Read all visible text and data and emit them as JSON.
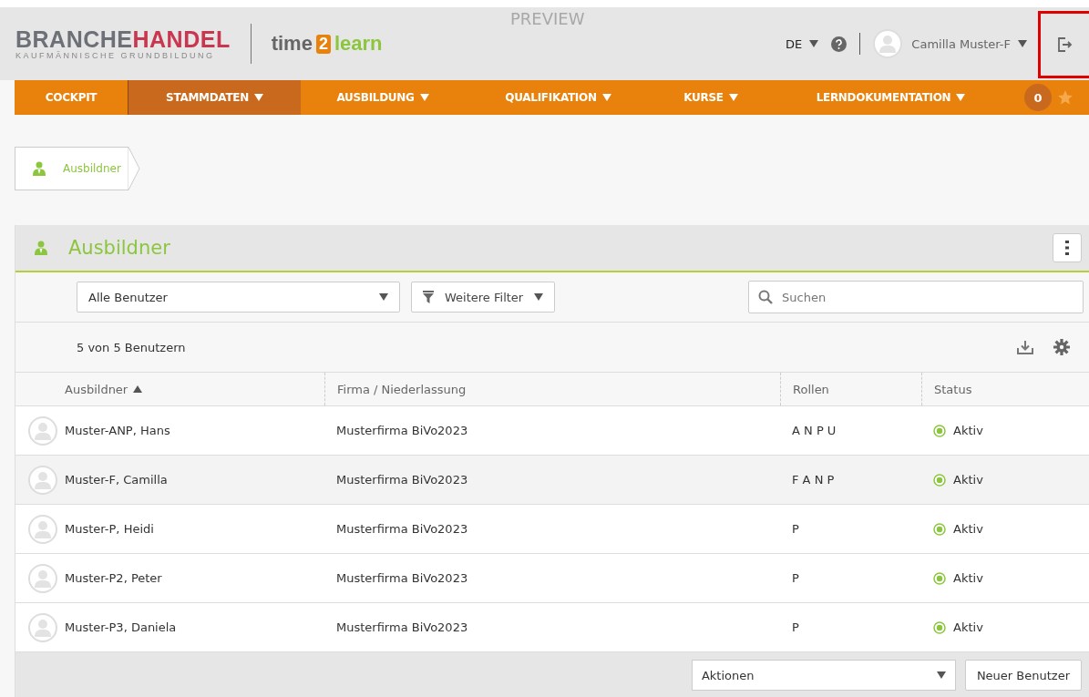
{
  "header": {
    "brand": {
      "part1": "BRANCHE",
      "part2": "HANDEL",
      "tagline": "KAUFMÄNNISCHE GRUNDBILDUNG"
    },
    "app_logo": {
      "part1": "time",
      "part2": "2",
      "part3": "learn"
    },
    "preview_label": "PREVIEW",
    "language": "DE",
    "user_name": "Camilla Muster-F",
    "logout_highlighted": true
  },
  "nav": {
    "items": [
      {
        "label": "COCKPIT",
        "dropdown": false,
        "selected": false
      },
      {
        "label": "STAMMDATEN",
        "dropdown": true,
        "selected": true
      },
      {
        "label": "AUSBILDUNG",
        "dropdown": true,
        "selected": false
      },
      {
        "label": "QUALIFIKATION",
        "dropdown": true,
        "selected": false
      },
      {
        "label": "KURSE",
        "dropdown": true,
        "selected": false
      },
      {
        "label": "LERNDOKUMENTATION",
        "dropdown": true,
        "selected": false
      }
    ],
    "badge": "0"
  },
  "breadcrumb": [
    "Ausbildner"
  ],
  "panel": {
    "title": "Ausbildner",
    "filter_select": "Alle Benutzer",
    "filter_button": "Weitere Filter",
    "search": {
      "placeholder": "Suchen"
    },
    "count": "5 von 5 Benutzern",
    "table": {
      "columns": [
        {
          "label": "Ausbildner",
          "sorted_ascending": true
        },
        {
          "label": "Firma / Niederlassung",
          "sorted_ascending": false
        },
        {
          "label": "Rollen",
          "sorted_ascending": false
        },
        {
          "label": "Status",
          "sorted_ascending": false
        }
      ],
      "rows": [
        {
          "name": "Muster-ANP, Hans",
          "company": "Musterfirma BiVo2023",
          "roles": "A N P U",
          "status": "Aktiv",
          "active": true,
          "shaded": false
        },
        {
          "name": "Muster-F, Camilla",
          "company": "Musterfirma BiVo2023",
          "roles": "F A N P",
          "status": "Aktiv",
          "active": true,
          "shaded": true
        },
        {
          "name": "Muster-P, Heidi",
          "company": "Musterfirma BiVo2023",
          "roles": "P",
          "status": "Aktiv",
          "active": true,
          "shaded": false
        },
        {
          "name": "Muster-P2, Peter",
          "company": "Musterfirma BiVo2023",
          "roles": "P",
          "status": "Aktiv",
          "active": true,
          "shaded": false
        },
        {
          "name": "Muster-P3, Daniela",
          "company": "Musterfirma BiVo2023",
          "roles": "P",
          "status": "Aktiv",
          "active": true,
          "shaded": false
        }
      ]
    },
    "actions_select": "Aktionen",
    "new_button": "Neuer Benutzer"
  }
}
